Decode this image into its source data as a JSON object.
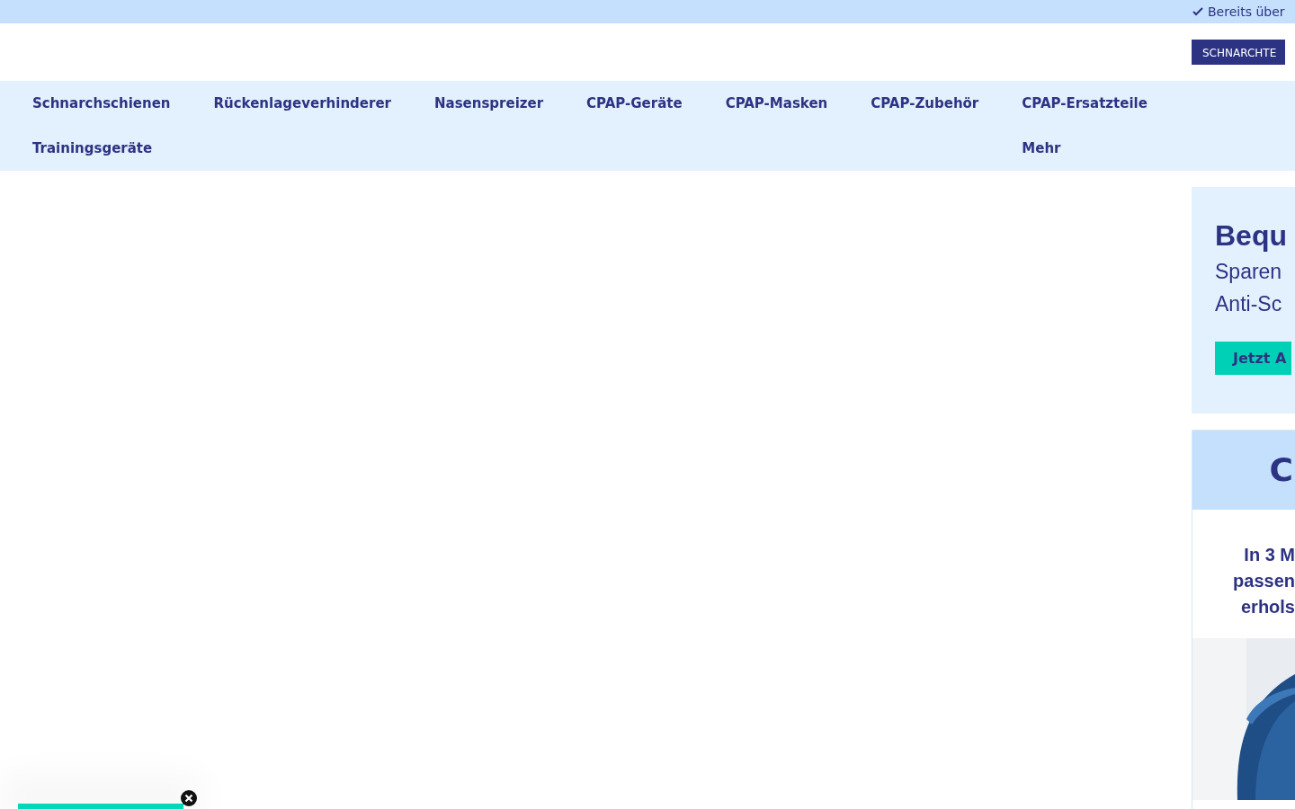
{
  "top_bar": {
    "text": "Bereits über"
  },
  "header": {
    "button": "SCHNARCHTE"
  },
  "nav": {
    "items": [
      {
        "label": "Schnarchschienen"
      },
      {
        "label": "Rückenlageverhinderer"
      },
      {
        "label": "Nasenspreizer"
      },
      {
        "label": "CPAP-Geräte"
      },
      {
        "label": "CPAP-Masken"
      },
      {
        "label": "CPAP-Zubehör"
      },
      {
        "label": "CPAP-Ersatzteile"
      },
      {
        "label": "Trainingsgeräte"
      }
    ],
    "more": "Mehr"
  },
  "promo": {
    "title": "Bequ",
    "lines": [
      "Sparen",
      "Anti-Sc"
    ],
    "button": "Jetzt A"
  },
  "card": {
    "heading": "C",
    "lines": [
      "In 3 M",
      "passen",
      "erhols"
    ]
  },
  "popup": {
    "close": true
  }
}
